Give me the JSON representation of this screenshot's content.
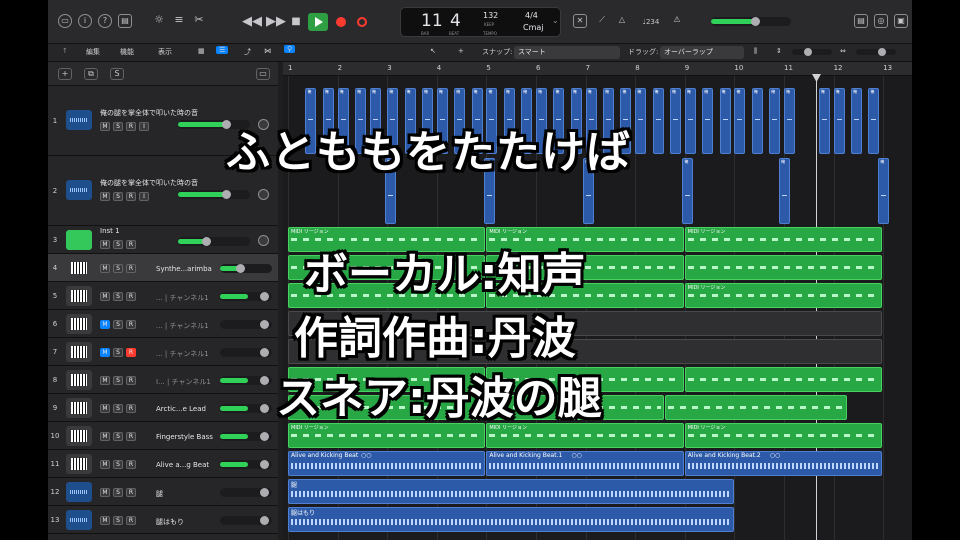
{
  "control_bar": {
    "lcd": {
      "bar": "11",
      "beat": "4",
      "bar_caption": "BAR",
      "beat_caption": "BEAT",
      "tempo": "132",
      "keep_caption": "KEEP",
      "tempo_caption": "TEMPO",
      "signature": "4/4",
      "key": "Cmaj"
    },
    "count_in": "♩234"
  },
  "menus": {
    "edit": "編集",
    "functions": "機能",
    "view": "表示"
  },
  "snap": {
    "label": "スナップ:",
    "value": "スマート"
  },
  "drag": {
    "label": "ドラッグ:",
    "value": "オーバーラップ"
  },
  "ruler": [
    "1",
    "2",
    "3",
    "4",
    "5",
    "6",
    "7",
    "8",
    "9",
    "10",
    "11",
    "12",
    "13"
  ],
  "tracks": [
    {
      "num": "1",
      "name": "俺の腿を掌全体で叩いた時の音",
      "type": "audio",
      "m": "M",
      "s": "S",
      "r": "R",
      "i": "I"
    },
    {
      "num": "2",
      "name": "俺の腿を掌全体で叩いた時の音",
      "type": "audio",
      "m": "M",
      "s": "S",
      "r": "R",
      "i": "I"
    },
    {
      "num": "3",
      "name": "Inst 1",
      "type": "midi",
      "m": "M",
      "s": "S",
      "r": "R"
    },
    {
      "num": "4",
      "name": "Synthe...arimba",
      "type": "synth",
      "m": "M",
      "s": "S",
      "r": "R"
    },
    {
      "num": "5",
      "name": "... | チャンネル1",
      "type": "piano",
      "m": "M",
      "s": "S",
      "r": "R"
    },
    {
      "num": "6",
      "name": "... | チャンネル1",
      "type": "piano",
      "m": "M",
      "s": "S",
      "r": "R"
    },
    {
      "num": "7",
      "name": "... | チャンネル1",
      "type": "piano",
      "m": "M",
      "s": "S",
      "r": "R"
    },
    {
      "num": "8",
      "name": "I... | チャンネル1",
      "type": "piano",
      "m": "M",
      "s": "S",
      "r": "R"
    },
    {
      "num": "9",
      "name": "Arctic...e Lead",
      "type": "synth",
      "m": "M",
      "s": "S",
      "r": "R"
    },
    {
      "num": "10",
      "name": "Fingerstyle Bass",
      "type": "bass",
      "m": "M",
      "s": "S",
      "r": "R"
    },
    {
      "num": "11",
      "name": "Alive a...g Beat",
      "type": "drum",
      "m": "M",
      "s": "S",
      "r": "R"
    },
    {
      "num": "12",
      "name": "腿",
      "type": "audio",
      "m": "M",
      "s": "S",
      "r": "R"
    },
    {
      "num": "13",
      "name": "腿はもり",
      "type": "audio",
      "m": "M",
      "s": "S",
      "r": "R"
    }
  ],
  "regions": {
    "midi": "MIDI リージョン",
    "beat1": "Alive and Kicking Beat",
    "beat2": "Alive and Kicking Beat.1",
    "beat3": "Alive and Kicking Beat.2",
    "loop_icon": "○○",
    "audio12": "腿",
    "audio13": "腿はもり",
    "slice": "俺"
  },
  "overlay": {
    "title": "ふとももをたたけば",
    "line1": "ボーカル:知声",
    "line2": "作詞作曲:丹波",
    "line3": "スネア:丹波の腿"
  },
  "colors": {
    "midi": "#28a745",
    "audio": "#2c5aa8",
    "play": "#2ea043",
    "record": "#ff3b30",
    "accent": "#0a84ff"
  }
}
